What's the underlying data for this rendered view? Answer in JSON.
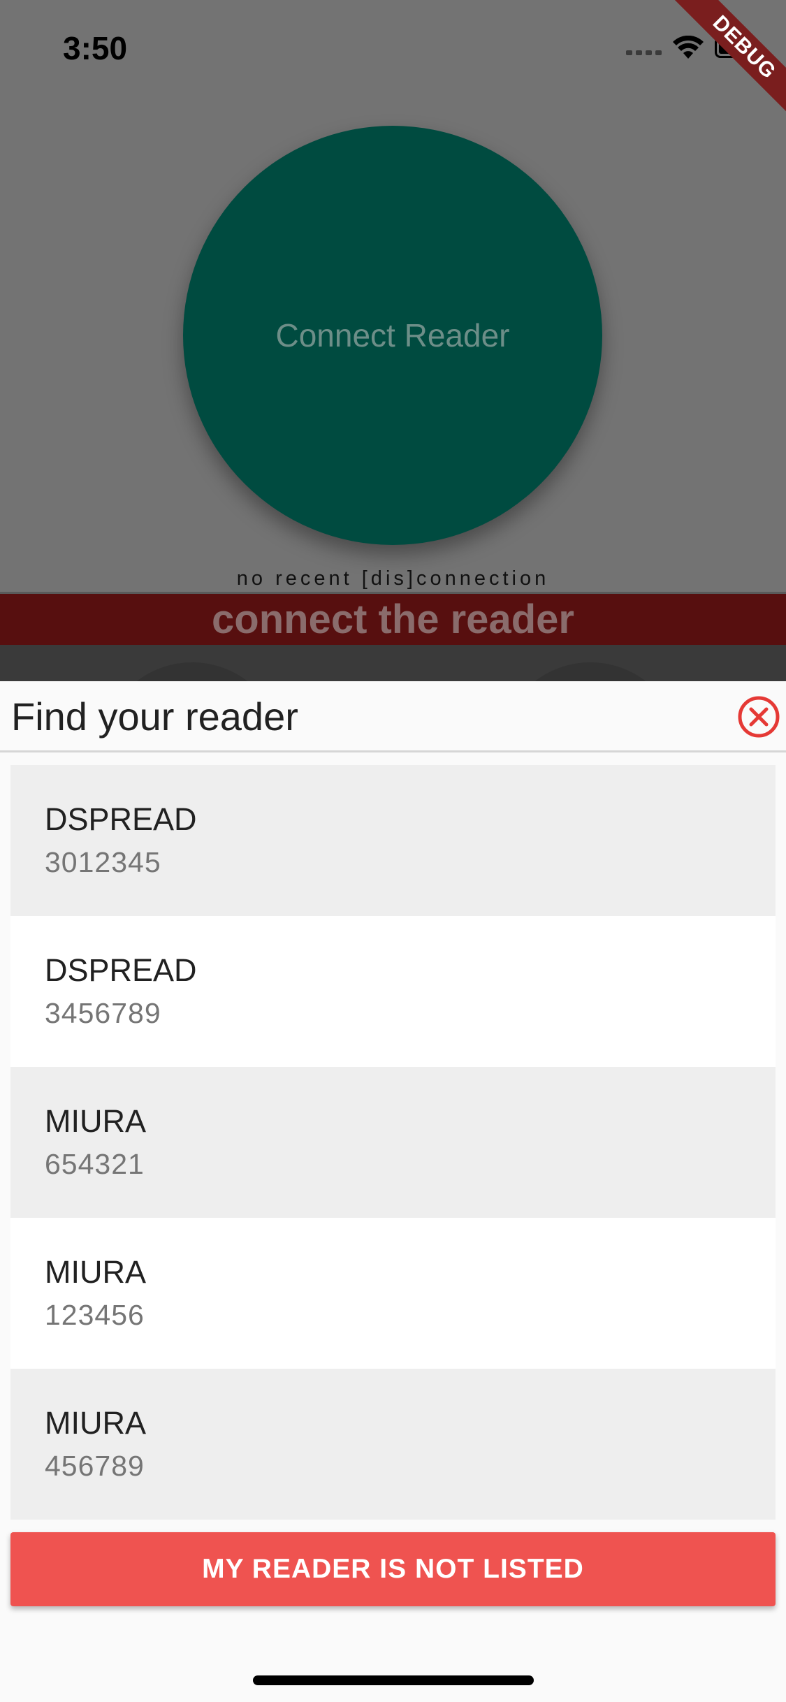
{
  "status_bar": {
    "time": "3:50",
    "icons": [
      "signal-dots-icon",
      "wifi-icon",
      "battery-icon"
    ]
  },
  "debug_ribbon": {
    "label": "DEBUG",
    "color": "#7a1e1e"
  },
  "background_app": {
    "connect_button_label": "Connect Reader",
    "connect_button_color": "#004b40",
    "connection_status": "no recent [dis]connection",
    "banner_text": "connect the reader",
    "banner_color": "#570f0f"
  },
  "sheet": {
    "title": "Find your reader",
    "close_icon": "close-circle-icon",
    "close_icon_color": "#e53935",
    "readers": [
      {
        "name": "DSPREAD",
        "serial": "3012345"
      },
      {
        "name": "DSPREAD",
        "serial": "3456789"
      },
      {
        "name": "MIURA",
        "serial": "654321"
      },
      {
        "name": "MIURA",
        "serial": "123456"
      },
      {
        "name": "MIURA",
        "serial": "456789"
      }
    ],
    "not_listed_button": "MY READER IS NOT LISTED",
    "not_listed_button_color": "#ef5350"
  }
}
